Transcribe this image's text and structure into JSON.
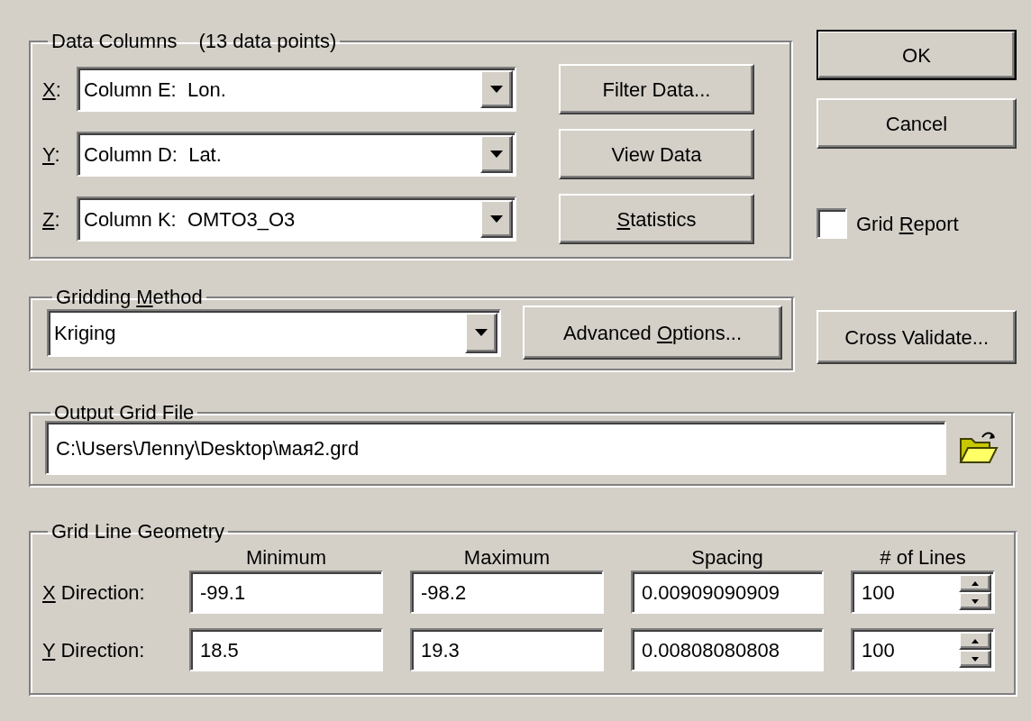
{
  "data_columns": {
    "title": "Data Columns",
    "note": "(13 data points)",
    "rows": [
      {
        "label": [
          {
            "text": "X",
            "underline": true
          },
          {
            "text": ":",
            "underline": false
          }
        ],
        "value": "Column E:  Lon."
      },
      {
        "label": [
          {
            "text": "Y",
            "underline": true
          },
          {
            "text": ":",
            "underline": false
          }
        ],
        "value": "Column D:  Lat."
      },
      {
        "label": [
          {
            "text": "Z",
            "underline": true
          },
          {
            "text": ":",
            "underline": false
          }
        ],
        "value": "Column K:  OMTO3_O3"
      }
    ],
    "buttons": [
      {
        "label": "Filter Data..."
      },
      {
        "label": "View Data"
      },
      {
        "label": [
          {
            "text": "S",
            "underline": true
          },
          {
            "text": "tatistics",
            "underline": false
          }
        ]
      }
    ]
  },
  "dialog_buttons": [
    {
      "label": "OK",
      "default": true
    },
    {
      "label": "Cancel",
      "default": false
    }
  ],
  "grid_report": {
    "label": [
      {
        "text": "Grid ",
        "underline": false
      },
      {
        "text": "R",
        "underline": true
      },
      {
        "text": "eport",
        "underline": false
      }
    ],
    "checked": false
  },
  "gridding_method": {
    "title": [
      {
        "text": "Gridding ",
        "underline": false
      },
      {
        "text": "M",
        "underline": true
      },
      {
        "text": "ethod",
        "underline": false
      }
    ],
    "value": "Kriging",
    "button": {
      "label": [
        {
          "text": "Advanced ",
          "underline": false
        },
        {
          "text": "O",
          "underline": true
        },
        {
          "text": "ptions...",
          "underline": false
        }
      ]
    }
  },
  "cross_validate": {
    "label": "Cross Validate..."
  },
  "output_grid_file": {
    "title": "Output Grid File",
    "value": "C:\\Users\\Лenny\\Desktop\\мая2.grd"
  },
  "geometry": {
    "title": "Grid Line Geometry",
    "headers": [
      "Minimum",
      "Maximum",
      "Spacing",
      "# of Lines"
    ],
    "rows": [
      {
        "label": [
          {
            "text": "X",
            "underline": true
          },
          {
            "text": " Direction:",
            "underline": false
          }
        ],
        "minimum": "-99.1",
        "maximum": "-98.2",
        "spacing": "0.00909090909",
        "lines": "100"
      },
      {
        "label": [
          {
            "text": "Y",
            "underline": true
          },
          {
            "text": " Direction:",
            "underline": false
          }
        ],
        "minimum": "18.5",
        "maximum": "19.3",
        "spacing": "0.00808080808",
        "lines": "100"
      }
    ]
  }
}
